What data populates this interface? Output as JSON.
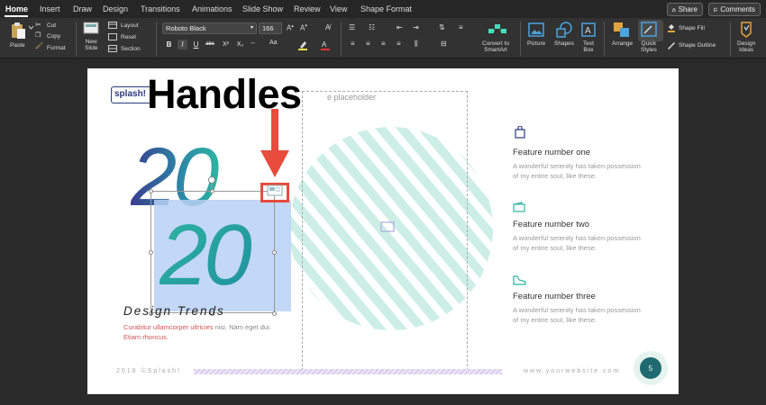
{
  "tabs": [
    {
      "label": "Home"
    },
    {
      "label": "Insert"
    },
    {
      "label": "Draw"
    },
    {
      "label": "Design"
    },
    {
      "label": "Transitions"
    },
    {
      "label": "Animations"
    },
    {
      "label": "Slide Show"
    },
    {
      "label": "Review"
    },
    {
      "label": "View"
    },
    {
      "label": "Shape Format"
    }
  ],
  "top_buttons": {
    "share": "Share",
    "comments": "Comments"
  },
  "ribbon": {
    "paste": "Paste",
    "cut": "Cut",
    "copy": "Copy",
    "format": "Format",
    "new_slide": "New\nSlide",
    "layout": "Layout",
    "reset": "Reset",
    "section": "Section",
    "font_name": "Roboto Black",
    "font_size": "166",
    "convert_smartart": "Convert to\nSmartArt",
    "picture": "Picture",
    "shapes": "Shapes",
    "text_box": "Text\nBox",
    "arrange": "Arrange",
    "quick_styles": "Quick\nStyles",
    "shape_fill": "Shape Fill",
    "shape_outline": "Shape Outline",
    "design_ideas": "Design\nIdeas",
    "format_buttons": [
      "B",
      "I",
      "U",
      "abc",
      "X²",
      "X₂"
    ]
  },
  "slide": {
    "logo": "splash!",
    "overlay_title": "Handles",
    "placeholder_label": "e placeholder",
    "big_number": "20",
    "design_trends": "Design Trends",
    "desc_red_1": "Curabitur ullamcorper ultricies",
    "desc_mid": " nisi. Nam eget dui.",
    "desc_red_2": "Etiam rhoncus.",
    "footer_left": "2018 ©Splash!",
    "footer_right": "www.yourwebsite.com",
    "page_number": "5",
    "features": [
      {
        "title": "Feature number one",
        "desc": "A wonderful serenity has taken possession of my entire soul, like these.",
        "icon": "shopping-bag-icon"
      },
      {
        "title": "Feature number two",
        "desc": "A wonderful serenity has taken possession of my entire soul, like these.",
        "icon": "wallet-icon"
      },
      {
        "title": "Feature number three",
        "desc": "A wonderful serenity has taken possession of my entire soul, like these.",
        "icon": "shoe-icon"
      }
    ]
  },
  "colors": {
    "accent_teal": "#2fb5a0",
    "gradient_navy": "#3b3b8f",
    "red_annotation": "#e84c3d"
  }
}
